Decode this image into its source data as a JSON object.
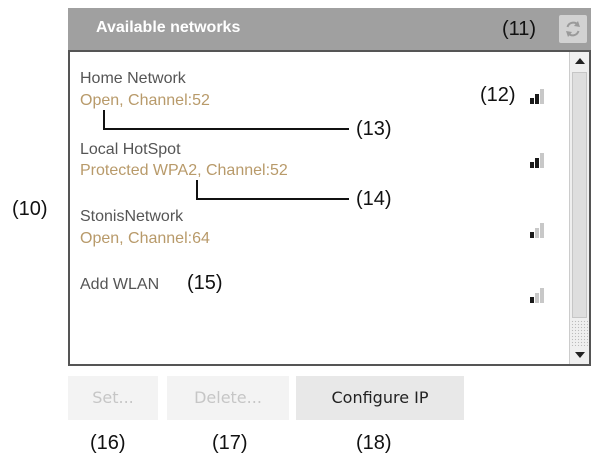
{
  "header": {
    "title": "Available networks",
    "refresh_icon": "refresh-icon"
  },
  "networks": [
    {
      "name": "Home Network",
      "detail": "Open, Channel:52",
      "signal_bars_active": 2
    },
    {
      "name": "Local HotSpot",
      "detail": "Protected WPA2, Channel:52",
      "signal_bars_active": 2
    },
    {
      "name": "StonisNetwork",
      "detail": "Open, Channel:64",
      "signal_bars_active": 1
    },
    {
      "name": "Add WLAN",
      "detail": "",
      "signal_bars_active": 1
    }
  ],
  "buttons": {
    "set": "Set...",
    "delete": "Delete...",
    "configure_ip": "Configure IP"
  },
  "callouts": {
    "c10": "(10)",
    "c11": "(11)",
    "c12": "(12)",
    "c13": "(13)",
    "c14": "(14)",
    "c15": "(15)",
    "c16": "(16)",
    "c17": "(17)",
    "c18": "(18)"
  },
  "colors": {
    "header_bg": "#a0a0a0",
    "detail_text": "#b89a6a",
    "signal_active": "#1a1a1a",
    "signal_inactive": "#c8c8c8"
  }
}
